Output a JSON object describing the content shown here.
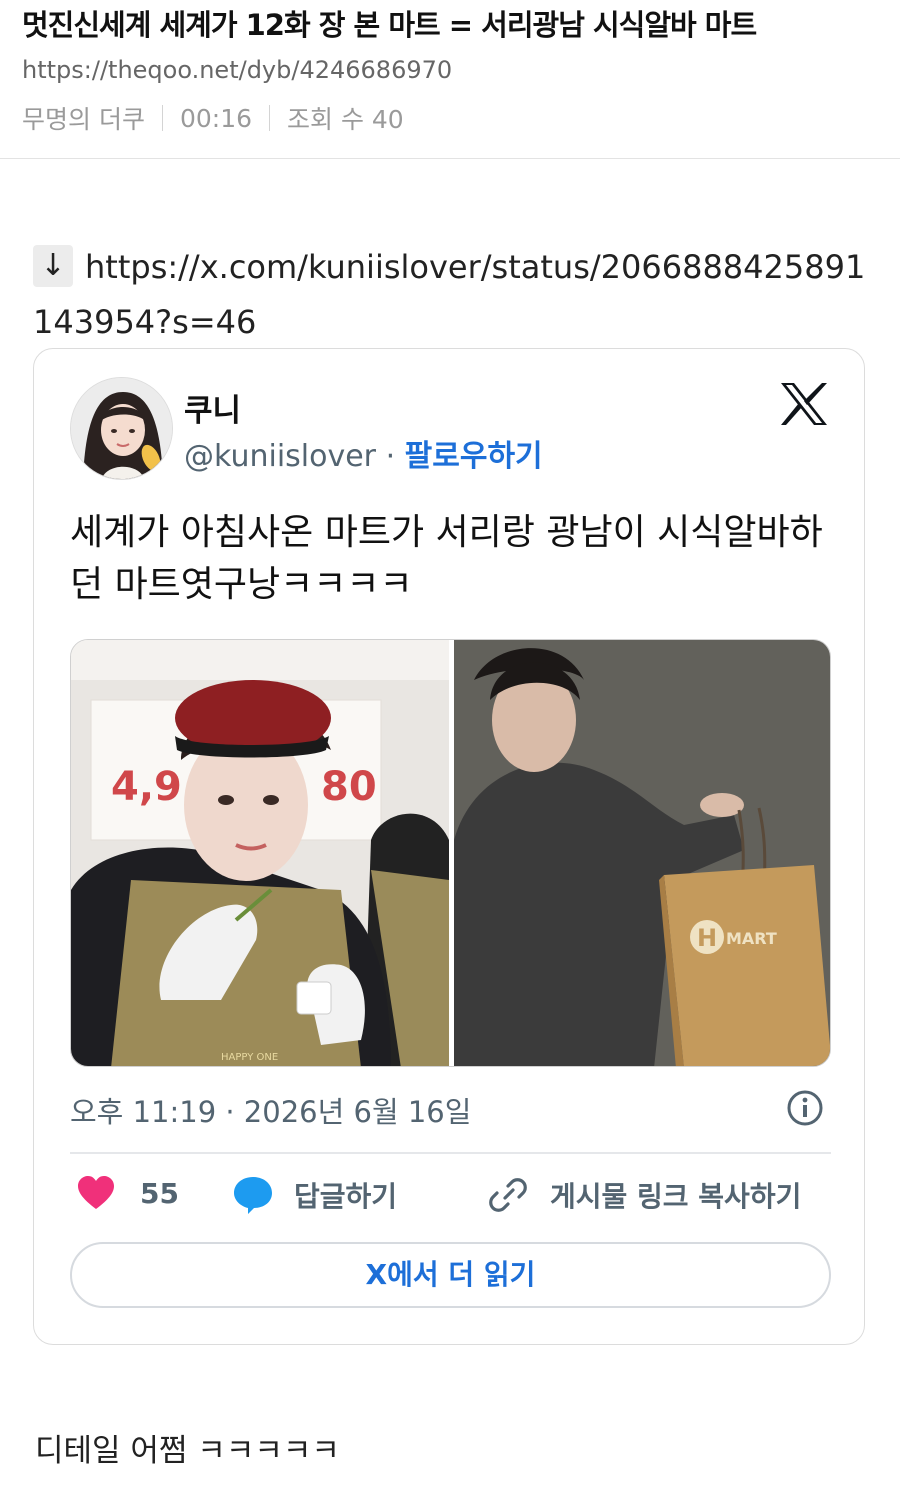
{
  "post": {
    "title": "멋진신세계 세계가 12화 장 본 마트 = 서리광남 시식알바 마트",
    "url": "https://theqoo.net/dyb/4246686970",
    "author": "무명의 더쿠",
    "time": "00:16",
    "views": "조회 수 40"
  },
  "link": {
    "arrow": "↓",
    "url": "https://x.com/kuniislover/status/2066888425891143954?s=46"
  },
  "tweet": {
    "author_name": "쿠니",
    "handle": "@kuniislover",
    "separator": "·",
    "follow_label": "팔로우하기",
    "text": "세계가 아침사온 마트가 서리랑 광남이 시식알바하던 마트엿구낭ㅋㅋㅋㅋ",
    "photo_left_sign": "4,9",
    "photo_left_sign2": "80",
    "photo_left_apron": "HAPPY ONE",
    "photo_right_bag_letter": "H",
    "photo_right_bag_text": "MART",
    "timestamp": "오후 11:19 · 2026년 6월 16일",
    "like_count": "55",
    "reply_label": "답글하기",
    "copy_label": "게시물 링크 복사하기",
    "read_more_label": "X에서 더 읽기"
  },
  "comment": {
    "text": "디테일 어쩜 ㅋㅋㅋㅋㅋ"
  },
  "colors": {
    "accent_blue": "#1d6fd8",
    "like_pink": "#f0307a",
    "reply_blue": "#1d9bf0",
    "muted_gray": "#536471"
  },
  "icons": {
    "arrow": "down-arrow-icon",
    "x_logo": "x-logo-icon",
    "info": "info-icon",
    "like": "heart-icon",
    "reply": "speech-bubble-icon",
    "copy": "link-icon"
  }
}
